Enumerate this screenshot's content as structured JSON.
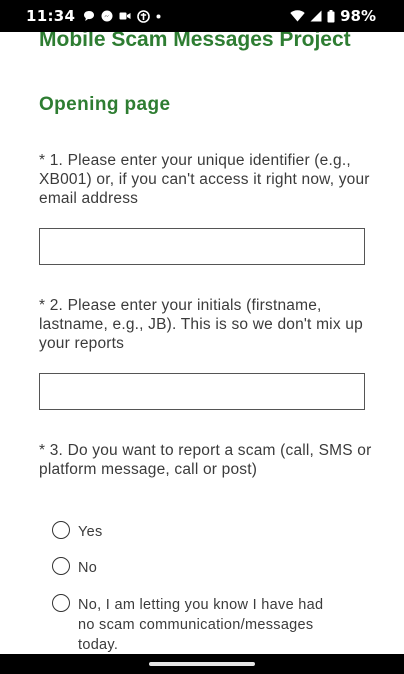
{
  "status_bar": {
    "time": "11:34",
    "battery": "98%",
    "notification_icons": [
      "chat-bubble-icon",
      "messenger-icon",
      "video-icon",
      "app-icon",
      "dot-icon"
    ],
    "system_icons": [
      "wifi-icon",
      "signal-icon",
      "battery-icon"
    ]
  },
  "survey": {
    "title": "Mobile Scam Messages Project",
    "section": "Opening page",
    "accent_color": "#2e7d32",
    "questions": [
      {
        "number": "* 1.",
        "text": "* 1. Please enter your unique identifier (e.g., XB001) or, if you can't access it right now, your email address",
        "answer": ""
      },
      {
        "number": "* 2.",
        "text": "* 2. Please enter your initials (firstname, lastname, e.g., JB). This is so we don't mix up your reports",
        "answer": ""
      },
      {
        "number": "* 3.",
        "text": "* 3. Do you want to report a scam (call, SMS or platform message, call or post)",
        "options": [
          "Yes",
          "No",
          "No, I am letting you know I have had no scam communication/messages today."
        ],
        "selected": null
      }
    ]
  }
}
